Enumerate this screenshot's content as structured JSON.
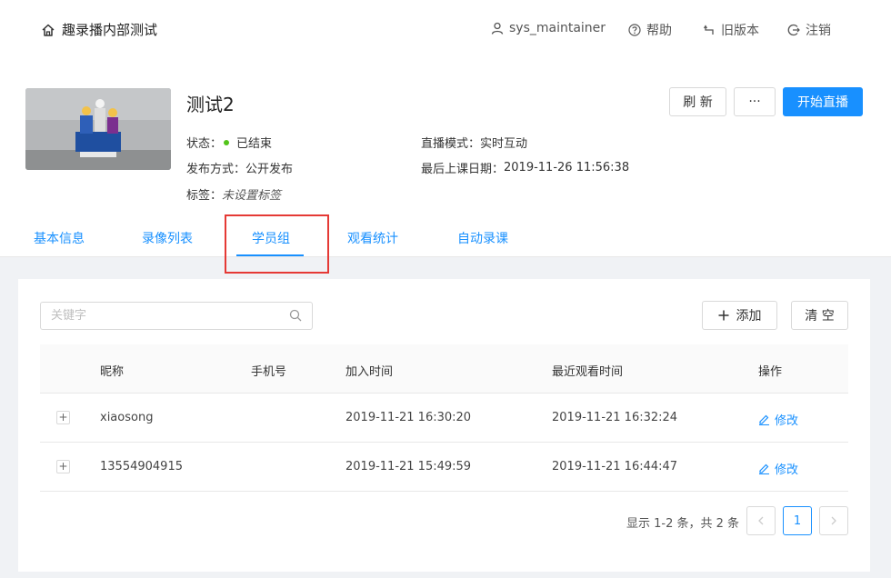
{
  "header": {
    "app_title": "趣录播内部测试",
    "user": "sys_maintainer",
    "help": "帮助",
    "old_version": "旧版本",
    "logout": "注销"
  },
  "course": {
    "title": "测试2",
    "status_label": "状态：",
    "status_value": "已结束",
    "mode_label": "直播模式：",
    "mode_value": "实时互动",
    "publish_label": "发布方式：",
    "publish_value": "公开发布",
    "last_date_label": "最后上课日期：",
    "last_date_value": "2019-11-26 11:56:38",
    "tags_label": "标签：",
    "tags_value": "未设置标签"
  },
  "actions": {
    "refresh": "刷 新",
    "more": "···",
    "start": "开始直播"
  },
  "tabs": [
    {
      "label": "基本信息"
    },
    {
      "label": "录像列表"
    },
    {
      "label": "学员组"
    },
    {
      "label": "观看统计"
    },
    {
      "label": "自动录课"
    }
  ],
  "toolbar": {
    "search_placeholder": "关键字",
    "add": "添加",
    "clear": "清 空"
  },
  "table": {
    "columns": [
      "昵称",
      "手机号",
      "加入时间",
      "最近观看时间",
      "操作"
    ],
    "rows": [
      {
        "nickname": "xiaosong",
        "phone": "",
        "joined": "2019-11-21 16:30:20",
        "last_view": "2019-11-21 16:32:24",
        "action": "修改"
      },
      {
        "nickname": "13554904915",
        "phone": "",
        "joined": "2019-11-21 15:49:59",
        "last_view": "2019-11-21 16:44:47",
        "action": "修改"
      }
    ]
  },
  "pagination": {
    "summary": "显示 1-2 条，共 2 条",
    "current_page": "1"
  },
  "colors": {
    "accent": "#1890ff",
    "status_dot": "#52c41a",
    "highlight": "#e53935"
  }
}
